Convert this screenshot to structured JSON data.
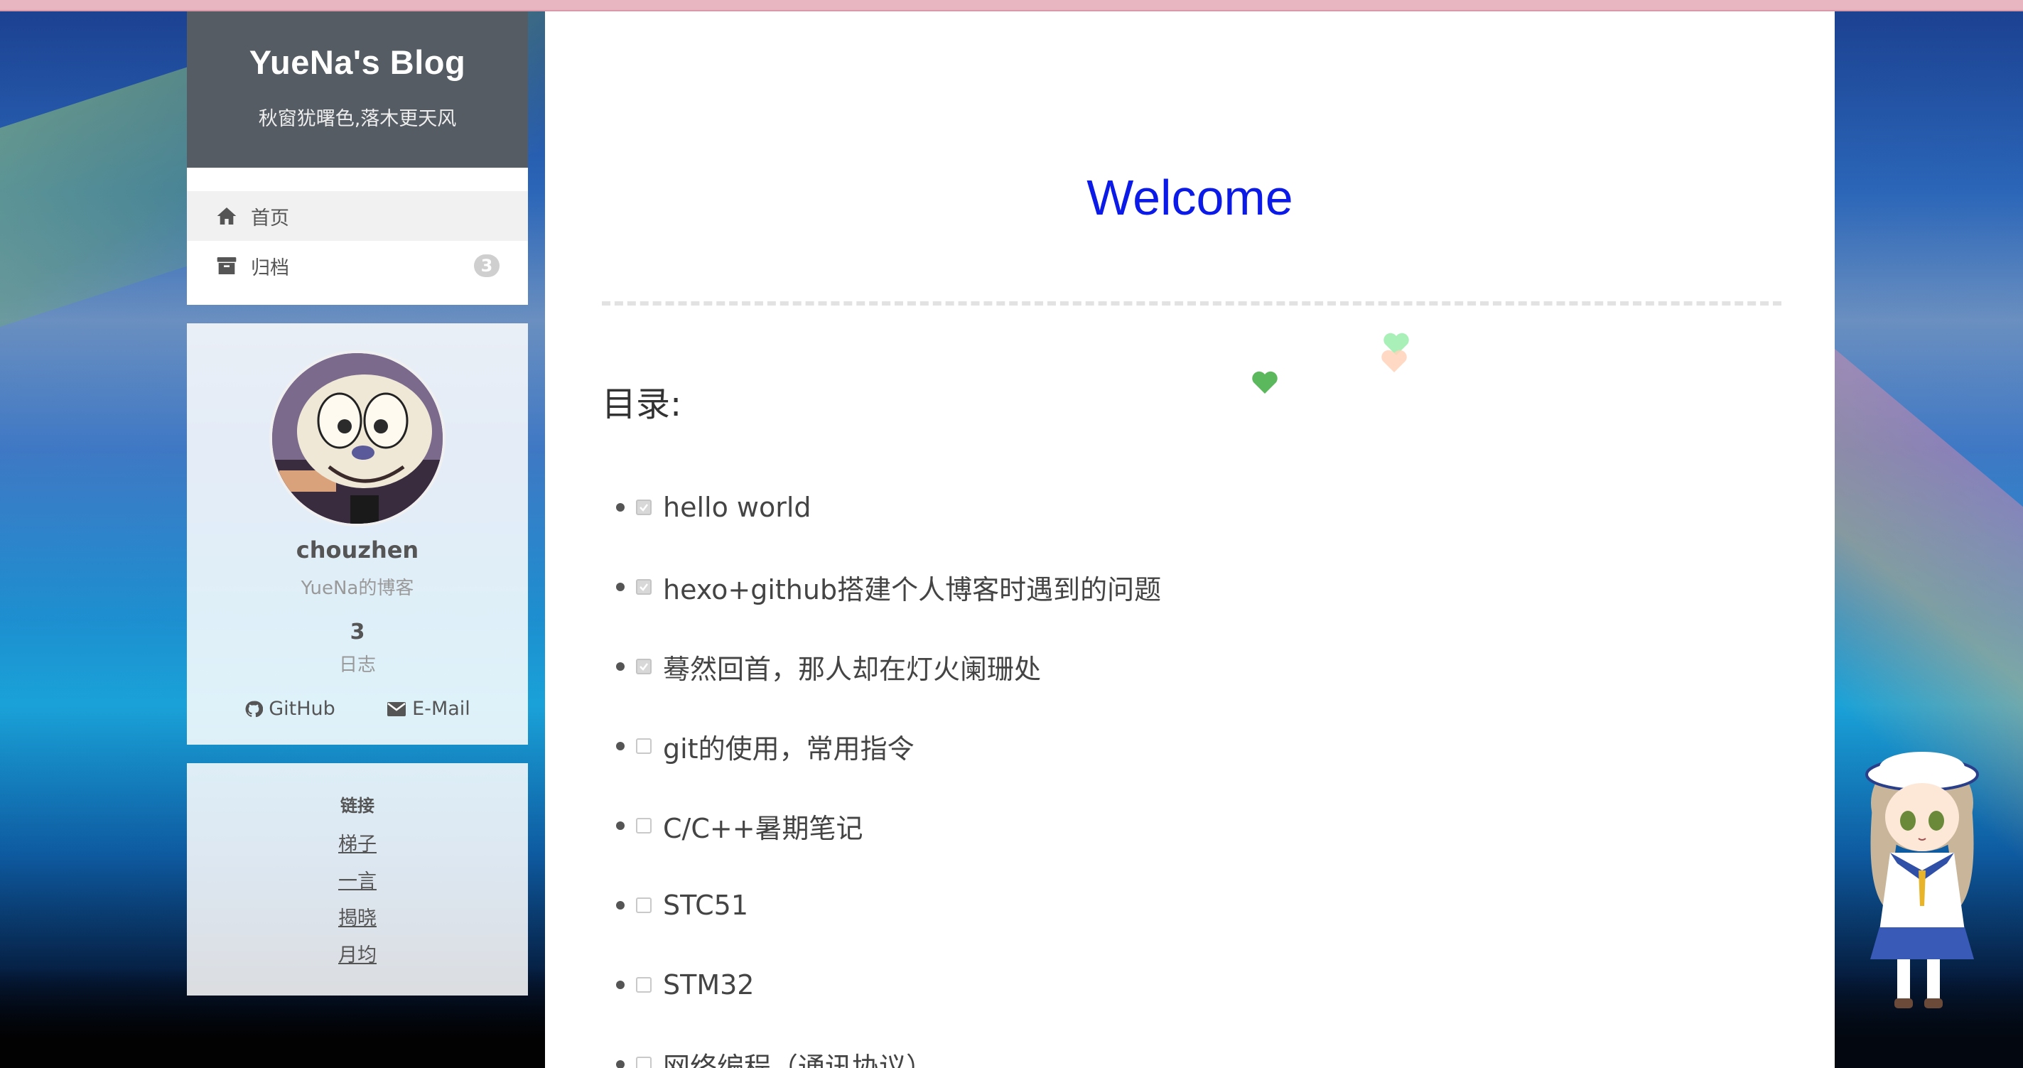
{
  "site": {
    "title": "YueNa's Blog",
    "subtitle": "秋窗犹曙色,落木更天风"
  },
  "menu": {
    "items": [
      {
        "label": "首页",
        "icon": "home-icon",
        "active": true
      },
      {
        "label": "归档",
        "icon": "archive-icon",
        "badge": "3"
      }
    ]
  },
  "profile": {
    "name": "chouzhen",
    "description": "YueNa的博客",
    "posts_count": "3",
    "posts_label": "日志",
    "social": [
      {
        "label": "GitHub",
        "icon": "github-icon"
      },
      {
        "label": "E-Mail",
        "icon": "envelope-icon"
      }
    ]
  },
  "links": {
    "title": "链接",
    "items": [
      "梯子",
      "一言",
      "揭晓",
      "月均"
    ]
  },
  "post": {
    "title": "Welcome",
    "toc_heading": "目录:",
    "todos": [
      {
        "text": "hello world",
        "checked": true
      },
      {
        "text": "hexo+github搭建个人博客时遇到的问题",
        "checked": true
      },
      {
        "text": "蓦然回首，那人却在灯火阑珊处",
        "checked": true
      },
      {
        "text": "git的使用，常用指令",
        "checked": false
      },
      {
        "text": "C/C++暑期笔记",
        "checked": false
      },
      {
        "text": "STC51",
        "checked": false
      },
      {
        "text": "STM32",
        "checked": false
      },
      {
        "text": "网络编程（通讯协议）",
        "checked": false
      }
    ]
  },
  "colors": {
    "title_blue": "#0b1ae6",
    "brand_bg": "#555c63",
    "top_bar": "#e8b6c0",
    "heart_green": "#5cb85c",
    "heart_light_green": "#a8f0b8",
    "heart_peach": "#ffd2b8"
  }
}
